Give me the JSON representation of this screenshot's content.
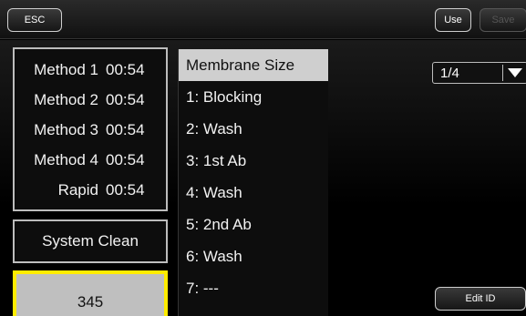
{
  "toolbar": {
    "esc_label": "ESC",
    "use_label": "Use",
    "save_label": "Save"
  },
  "methods": [
    {
      "name": "Method 1",
      "time": "00:54"
    },
    {
      "name": "Method 2",
      "time": "00:54"
    },
    {
      "name": "Method 3",
      "time": "00:54"
    },
    {
      "name": "Method 4",
      "time": "00:54"
    },
    {
      "name": "Rapid",
      "time": "00:54"
    }
  ],
  "system_clean_label": "System Clean",
  "number_value": "345",
  "steps": {
    "header": "Membrane Size",
    "items": [
      "1: Blocking",
      "2: Wash",
      "3: 1st Ab",
      "4: Wash",
      "5: 2nd Ab",
      "6: Wash",
      "7: ---"
    ]
  },
  "page_select": {
    "value": "1/4"
  },
  "edit_id_label": "Edit ID",
  "colors": {
    "highlight_border": "#ffec00",
    "header_bg": "#cfcfcf",
    "disabled_text": "#555555"
  },
  "icons": {
    "dropdown_arrow": "chevron-down-icon"
  }
}
